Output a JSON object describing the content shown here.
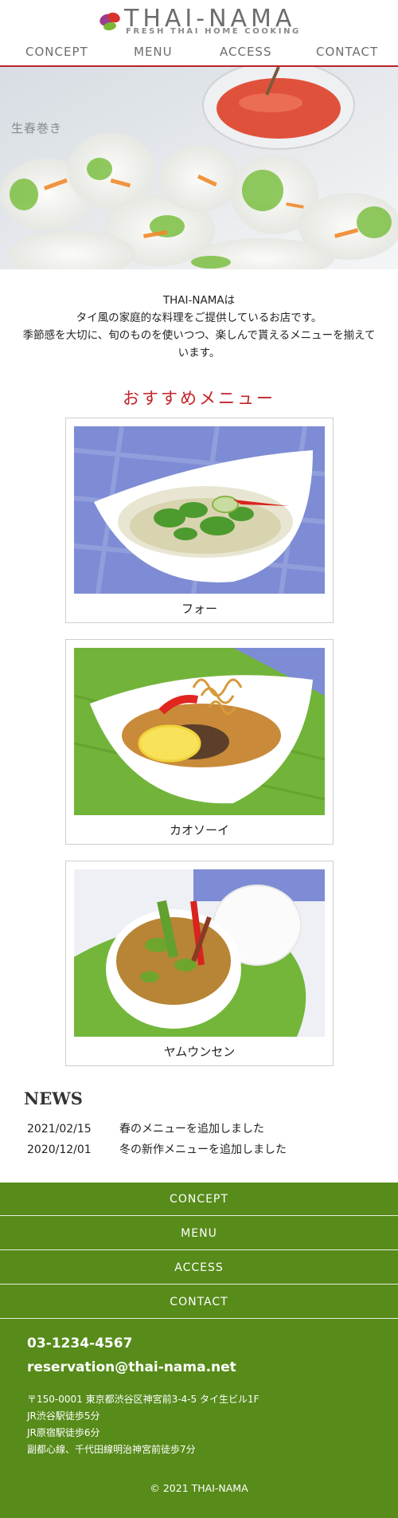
{
  "header": {
    "logo_text": "THAI-NAMA",
    "logo_sub": "FRESH THAI HOME COOKING",
    "nav": [
      "CONCEPT",
      "MENU",
      "ACCESS",
      "CONTACT"
    ]
  },
  "hero": {
    "caption": "生春巻き"
  },
  "intro": {
    "line1": "THAI-NAMAは",
    "line2": "タイ風の家庭的な料理をご提供しているお店です。",
    "line3": "季節感を大切に、旬のものを使いつつ、楽しんで貰えるメニューを揃えています。"
  },
  "menu": {
    "title": "おすすめメニュー",
    "items": [
      {
        "name": "フォー"
      },
      {
        "name": "カオソーイ"
      },
      {
        "name": "ヤムウンセン"
      }
    ]
  },
  "news": {
    "title": "NEWS",
    "items": [
      {
        "date": "2021/02/15",
        "text": "春のメニューを追加しました"
      },
      {
        "date": "2020/12/01",
        "text": "冬の新作メニューを追加しました"
      }
    ]
  },
  "footer": {
    "nav": [
      "CONCEPT",
      "MENU",
      "ACCESS",
      "CONTACT"
    ],
    "phone": "03-1234-4567",
    "email": "reservation@thai-nama.net",
    "address": [
      "〒150-0001 東京都渋谷区神宮前3-4-5 タイ生ビル1F",
      "JR渋谷駅徒歩5分",
      "JR原宿駅徒歩6分",
      "副都心線、千代田線明治神宮前徒歩7分"
    ],
    "copyright": "© 2021 THAI-NAMA"
  },
  "colors": {
    "accent": "#c3242a",
    "footer_green": "#578b1a",
    "nav_gray": "#6d6d6d"
  }
}
